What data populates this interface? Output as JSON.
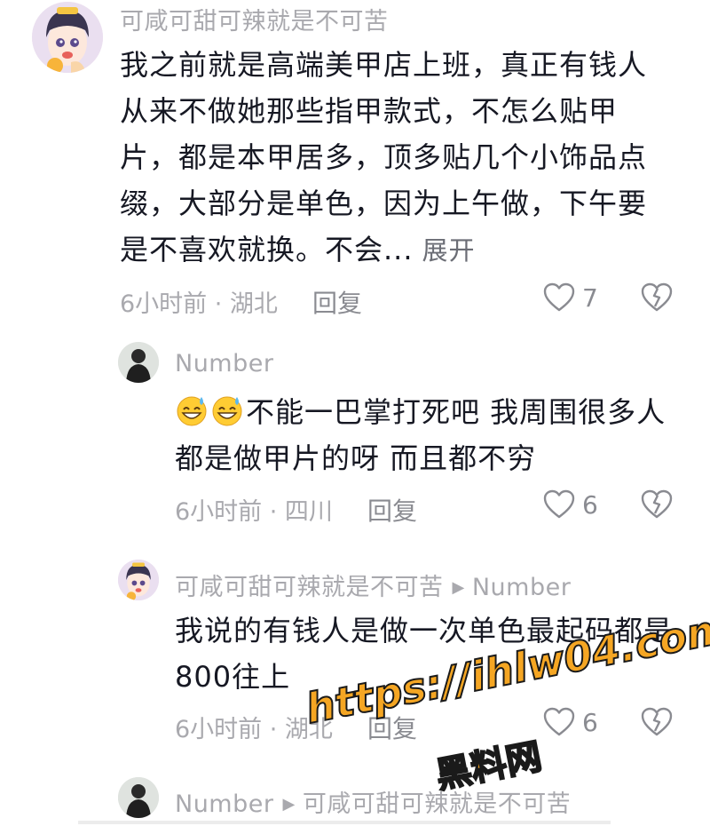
{
  "comments": [
    {
      "username": "可咸可甜可辣就是不可苦",
      "lines": [
        "我之前就是高端美甲店上班，真正有钱人",
        "从来不做她那些指甲款式，不怎么贴甲",
        "片，都是本甲居多，顶多贴几个小饰品点",
        "缀，大部分是单色，因为上午做，下午要",
        "是不喜欢就换。不会..."
      ],
      "expand_label": "展开",
      "meta": "6小时前 · 湖北",
      "reply_label": "回复",
      "like_count": "7"
    },
    {
      "username": "Number",
      "lines": [
        "不能一巴掌打死吧 我周围很多人",
        "都是做甲片的呀 而且都不穷"
      ],
      "emoji": "grinning-sweat-emoji",
      "meta": "6小时前 · 四川",
      "reply_label": "回复",
      "like_count": "6"
    },
    {
      "username": "可咸可甜可辣就是不可苦",
      "reply_to": "Number",
      "lines": [
        "我说的有钱人是做一次单色最起码都是",
        "800往上"
      ],
      "meta": "6小时前 · 湖北",
      "reply_label": "回复",
      "like_count": "6"
    },
    {
      "username": "Number",
      "reply_to": "可咸可甜可辣就是不可苦"
    }
  ],
  "watermark": {
    "url": "https://ihlw04.com",
    "brand": "黑料网"
  },
  "colors": {
    "text": "#161823",
    "secondary": "#a9a9ae",
    "watermark": "#f5a623"
  },
  "icons": [
    "heart-outline-icon",
    "broken-heart-icon",
    "triangle-right-icon"
  ]
}
